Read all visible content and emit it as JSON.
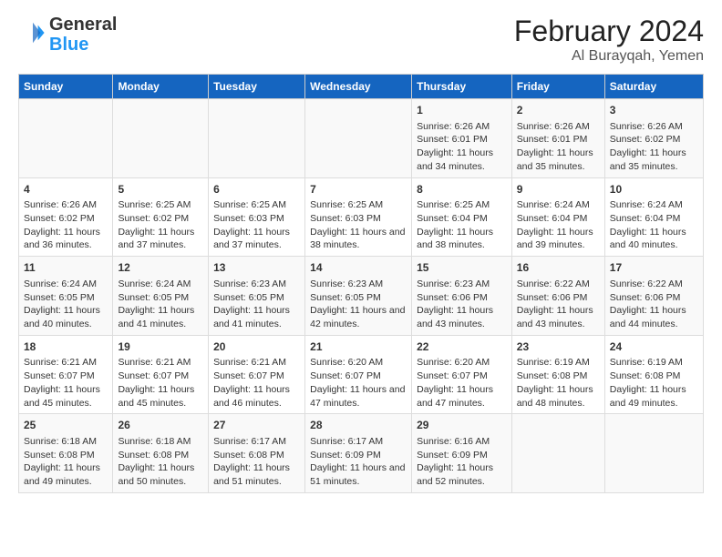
{
  "header": {
    "logo_line1": "General",
    "logo_line2": "Blue",
    "title": "February 2024",
    "subtitle": "Al Burayqah, Yemen"
  },
  "columns": [
    "Sunday",
    "Monday",
    "Tuesday",
    "Wednesday",
    "Thursday",
    "Friday",
    "Saturday"
  ],
  "weeks": [
    [
      {
        "day": "",
        "info": ""
      },
      {
        "day": "",
        "info": ""
      },
      {
        "day": "",
        "info": ""
      },
      {
        "day": "",
        "info": ""
      },
      {
        "day": "1",
        "info": "Sunrise: 6:26 AM\nSunset: 6:01 PM\nDaylight: 11 hours and 34 minutes."
      },
      {
        "day": "2",
        "info": "Sunrise: 6:26 AM\nSunset: 6:01 PM\nDaylight: 11 hours and 35 minutes."
      },
      {
        "day": "3",
        "info": "Sunrise: 6:26 AM\nSunset: 6:02 PM\nDaylight: 11 hours and 35 minutes."
      }
    ],
    [
      {
        "day": "4",
        "info": "Sunrise: 6:26 AM\nSunset: 6:02 PM\nDaylight: 11 hours and 36 minutes."
      },
      {
        "day": "5",
        "info": "Sunrise: 6:25 AM\nSunset: 6:02 PM\nDaylight: 11 hours and 37 minutes."
      },
      {
        "day": "6",
        "info": "Sunrise: 6:25 AM\nSunset: 6:03 PM\nDaylight: 11 hours and 37 minutes."
      },
      {
        "day": "7",
        "info": "Sunrise: 6:25 AM\nSunset: 6:03 PM\nDaylight: 11 hours and 38 minutes."
      },
      {
        "day": "8",
        "info": "Sunrise: 6:25 AM\nSunset: 6:04 PM\nDaylight: 11 hours and 38 minutes."
      },
      {
        "day": "9",
        "info": "Sunrise: 6:24 AM\nSunset: 6:04 PM\nDaylight: 11 hours and 39 minutes."
      },
      {
        "day": "10",
        "info": "Sunrise: 6:24 AM\nSunset: 6:04 PM\nDaylight: 11 hours and 40 minutes."
      }
    ],
    [
      {
        "day": "11",
        "info": "Sunrise: 6:24 AM\nSunset: 6:05 PM\nDaylight: 11 hours and 40 minutes."
      },
      {
        "day": "12",
        "info": "Sunrise: 6:24 AM\nSunset: 6:05 PM\nDaylight: 11 hours and 41 minutes."
      },
      {
        "day": "13",
        "info": "Sunrise: 6:23 AM\nSunset: 6:05 PM\nDaylight: 11 hours and 41 minutes."
      },
      {
        "day": "14",
        "info": "Sunrise: 6:23 AM\nSunset: 6:05 PM\nDaylight: 11 hours and 42 minutes."
      },
      {
        "day": "15",
        "info": "Sunrise: 6:23 AM\nSunset: 6:06 PM\nDaylight: 11 hours and 43 minutes."
      },
      {
        "day": "16",
        "info": "Sunrise: 6:22 AM\nSunset: 6:06 PM\nDaylight: 11 hours and 43 minutes."
      },
      {
        "day": "17",
        "info": "Sunrise: 6:22 AM\nSunset: 6:06 PM\nDaylight: 11 hours and 44 minutes."
      }
    ],
    [
      {
        "day": "18",
        "info": "Sunrise: 6:21 AM\nSunset: 6:07 PM\nDaylight: 11 hours and 45 minutes."
      },
      {
        "day": "19",
        "info": "Sunrise: 6:21 AM\nSunset: 6:07 PM\nDaylight: 11 hours and 45 minutes."
      },
      {
        "day": "20",
        "info": "Sunrise: 6:21 AM\nSunset: 6:07 PM\nDaylight: 11 hours and 46 minutes."
      },
      {
        "day": "21",
        "info": "Sunrise: 6:20 AM\nSunset: 6:07 PM\nDaylight: 11 hours and 47 minutes."
      },
      {
        "day": "22",
        "info": "Sunrise: 6:20 AM\nSunset: 6:07 PM\nDaylight: 11 hours and 47 minutes."
      },
      {
        "day": "23",
        "info": "Sunrise: 6:19 AM\nSunset: 6:08 PM\nDaylight: 11 hours and 48 minutes."
      },
      {
        "day": "24",
        "info": "Sunrise: 6:19 AM\nSunset: 6:08 PM\nDaylight: 11 hours and 49 minutes."
      }
    ],
    [
      {
        "day": "25",
        "info": "Sunrise: 6:18 AM\nSunset: 6:08 PM\nDaylight: 11 hours and 49 minutes."
      },
      {
        "day": "26",
        "info": "Sunrise: 6:18 AM\nSunset: 6:08 PM\nDaylight: 11 hours and 50 minutes."
      },
      {
        "day": "27",
        "info": "Sunrise: 6:17 AM\nSunset: 6:08 PM\nDaylight: 11 hours and 51 minutes."
      },
      {
        "day": "28",
        "info": "Sunrise: 6:17 AM\nSunset: 6:09 PM\nDaylight: 11 hours and 51 minutes."
      },
      {
        "day": "29",
        "info": "Sunrise: 6:16 AM\nSunset: 6:09 PM\nDaylight: 11 hours and 52 minutes."
      },
      {
        "day": "",
        "info": ""
      },
      {
        "day": "",
        "info": ""
      }
    ]
  ]
}
